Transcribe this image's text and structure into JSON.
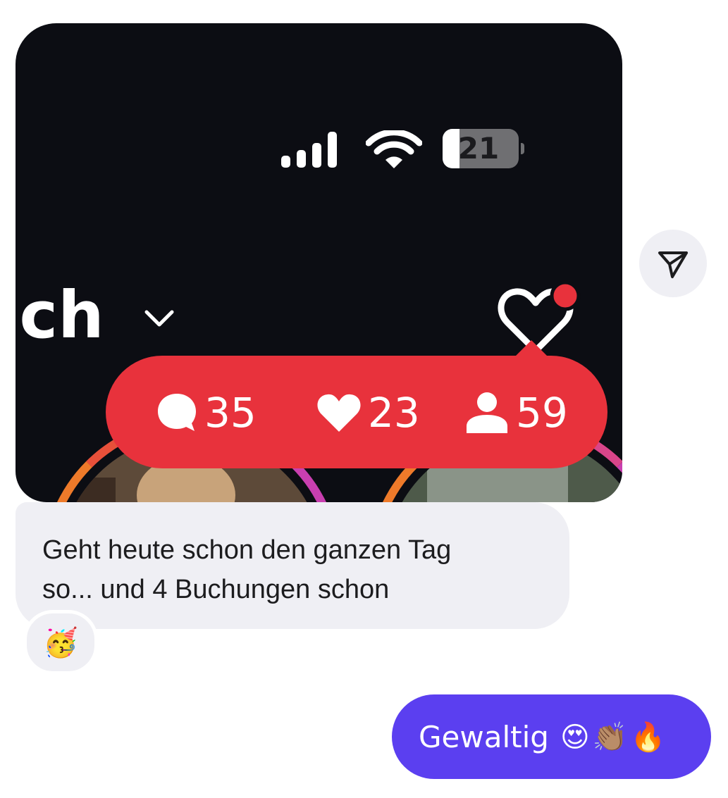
{
  "image_message": {
    "status_bar": {
      "battery": "21"
    },
    "profile": {
      "username_fragment": "ich"
    },
    "activity_notification": {
      "comments": "35",
      "likes": "23",
      "followers": "59"
    }
  },
  "received_message": {
    "line1": "Geht heute schon den ganzen Tag",
    "line2": "so... und 4 Buchungen schon",
    "reaction": "🥳"
  },
  "sent_message": {
    "text": "Gewaltig",
    "emojis": "😍👏🏽🔥"
  },
  "colors": {
    "accent": "#5b3ff0",
    "notification_red": "#e8323c",
    "bubble_gray": "#efeff4"
  }
}
